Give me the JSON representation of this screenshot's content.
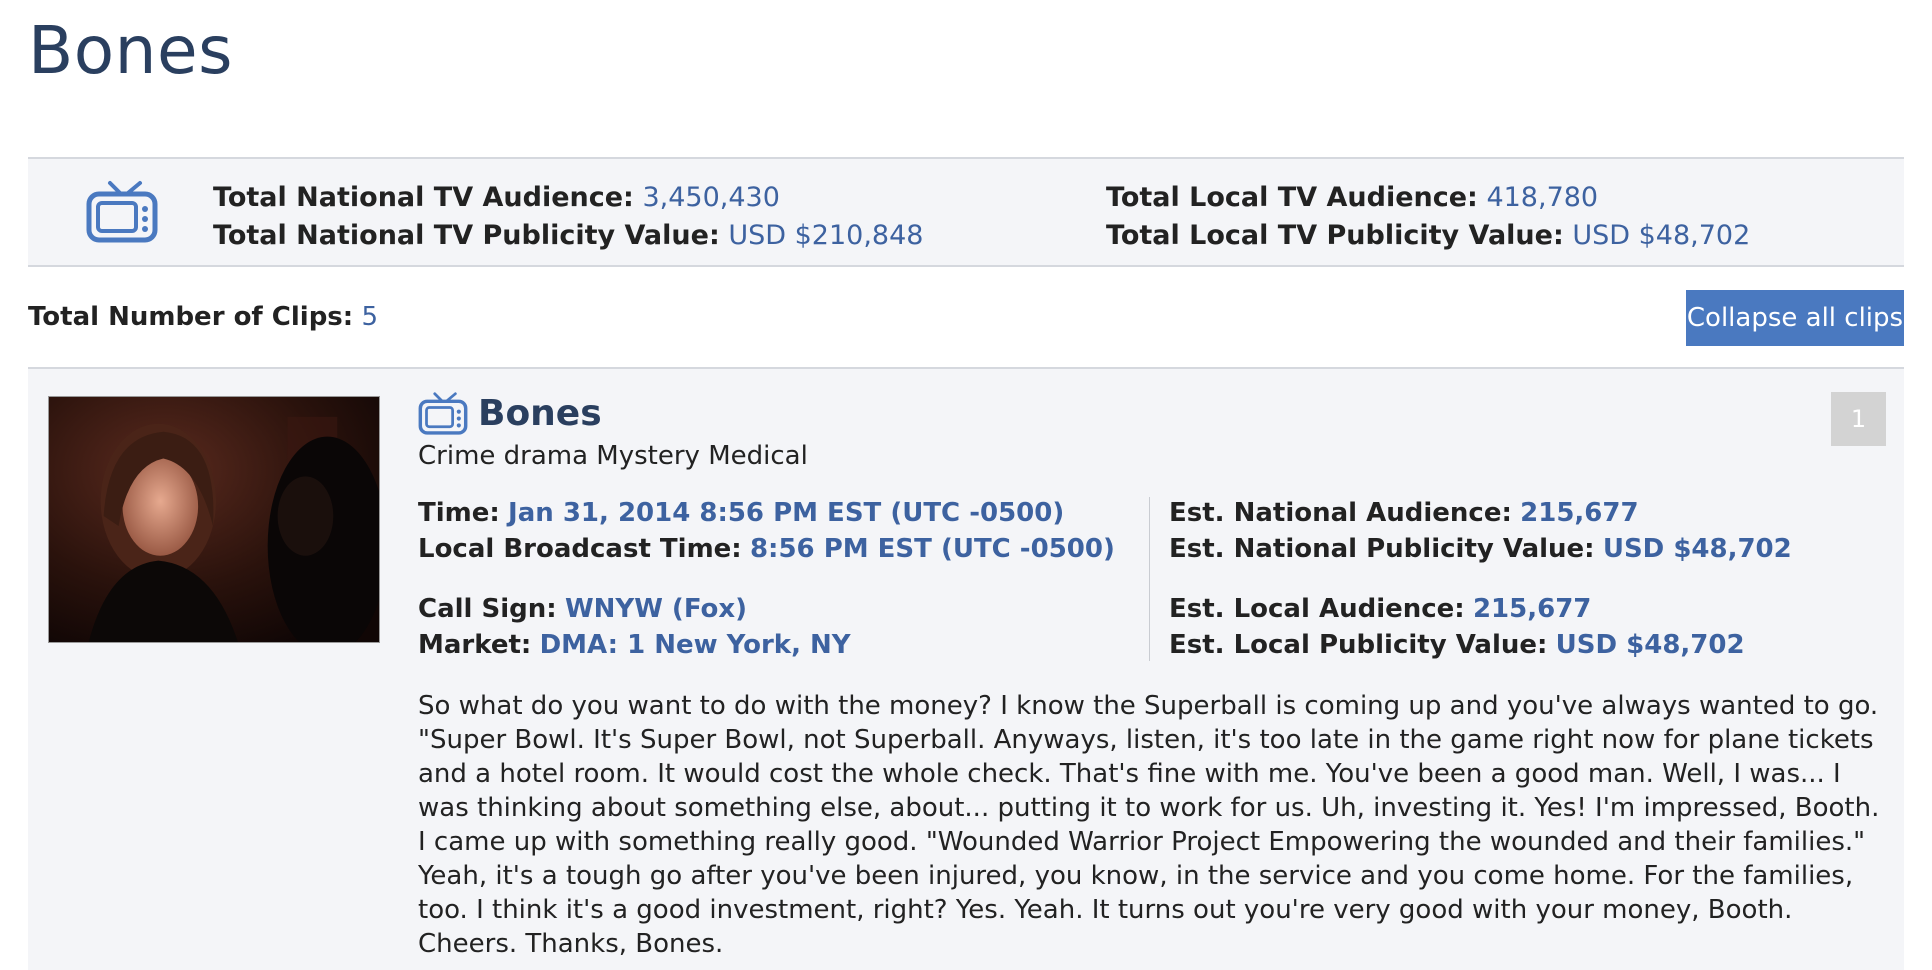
{
  "page": {
    "title": "Bones"
  },
  "summary": {
    "national_audience_label": "Total National TV Audience:",
    "national_audience_value": "3,450,430",
    "national_value_label": "Total National TV Publicity Value:",
    "national_value_value": "USD $210,848",
    "local_audience_label": "Total Local TV Audience:",
    "local_audience_value": "418,780",
    "local_value_label": "Total Local TV Publicity Value:",
    "local_value_value": "USD $48,702",
    "icon": "tv-icon"
  },
  "clips": {
    "count_label": "Total Number of Clips:",
    "count_value": "5",
    "collapse_label": "Collapse all clips"
  },
  "clip": {
    "index": "1",
    "title": "Bones",
    "genre": "Crime drama Mystery Medical",
    "time_label": "Time:",
    "time_value": "Jan 31, 2014 8:56 PM EST (UTC -0500)",
    "local_time_label": "Local Broadcast Time:",
    "local_time_value": "8:56 PM EST (UTC -0500)",
    "call_sign_label": "Call Sign:",
    "call_sign_value": "WNYW (Fox)",
    "market_label": "Market:",
    "market_value": "DMA: 1 New York, NY",
    "nat_aud_label": "Est. National Audience:",
    "nat_aud_value": "215,677",
    "nat_pub_label": "Est. National Publicity Value:",
    "nat_pub_value": "USD $48,702",
    "loc_aud_label": "Est. Local Audience:",
    "loc_aud_value": "215,677",
    "loc_pub_label": "Est. Local Publicity Value:",
    "loc_pub_value": "USD $48,702",
    "transcript": "So what do you want to do with the money? I know the Superball is coming up and you've always wanted to go. \"Super Bowl. It's Super Bowl, not Superball. Anyways, listen, it's too late in the game right now for plane tickets and a hotel room. It would cost the whole check. That's fine with me. You've been a good man. Well, I was... I was thinking about something else, about... putting it to work for us. Uh, investing it. Yes! I'm impressed, Booth. I came up with something really good. \"Wounded Warrior Project Empowering the wounded and their families.\" Yeah, it's a tough go after you've been injured, you know, in the service and you come home. For the families, too. I think it's a good investment, right? Yes. Yeah. It turns out you're very good with your money, Booth. Cheers. Thanks, Bones."
  },
  "colors": {
    "accent": "#3d62a0",
    "title": "#2a3f5f",
    "button": "#4a79c0",
    "panel": "#f4f5f8"
  }
}
